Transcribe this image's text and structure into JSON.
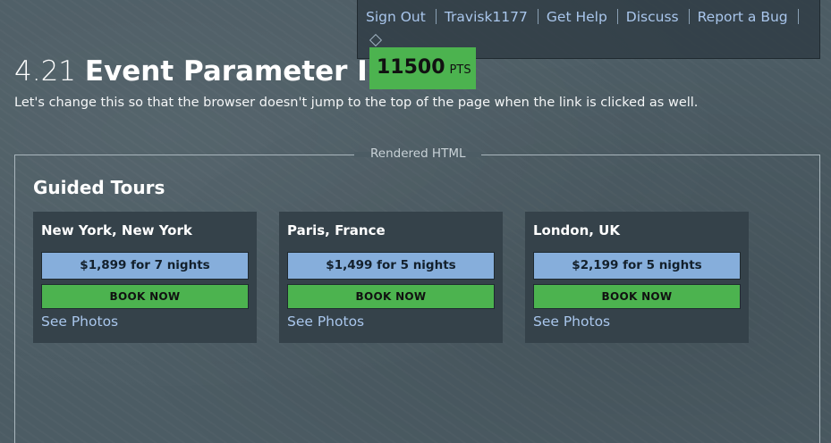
{
  "nav": {
    "links": [
      "Sign Out",
      "Travisk1177",
      "Get Help",
      "Discuss",
      "Report a Bug"
    ]
  },
  "challenge": {
    "number": "4.21",
    "name": "Event Parameter II",
    "points": "11500",
    "points_unit": "PTS",
    "description": "Let's change this so that the browser doesn't jump to the top of the page when the link is clicked as well."
  },
  "frame": {
    "legend": "Rendered HTML"
  },
  "tours": {
    "title": "Guided Tours",
    "items": [
      {
        "city": "New York, New York",
        "price": "$1,899 for 7 nights",
        "book": "BOOK NOW",
        "photos": "See Photos"
      },
      {
        "city": "Paris, France",
        "price": "$1,499 for 5 nights",
        "book": "BOOK NOW",
        "photos": "See Photos"
      },
      {
        "city": "London, UK",
        "price": "$2,199 for 5 nights",
        "book": "BOOK NOW",
        "photos": "See Photos"
      }
    ]
  },
  "colors": {
    "background": "#4c5c64",
    "accent_green": "#4cb34f",
    "price_blue": "#86aedb",
    "link_blue": "#a9c6ec",
    "card": "#35424a"
  },
  "icons": {
    "nav_toggle": "diamond-icon"
  }
}
